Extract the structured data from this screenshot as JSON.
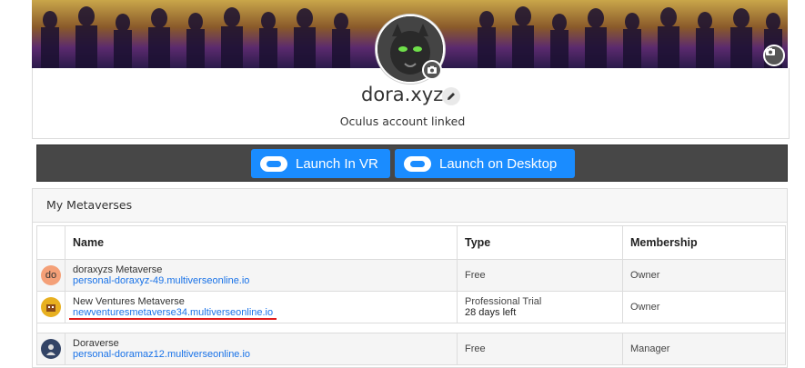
{
  "profile": {
    "username": "dora.xyz",
    "oculus_status": "Oculus account linked"
  },
  "launch": {
    "vr_label": "Launch In VR",
    "desktop_label": "Launch on Desktop"
  },
  "metaverses": {
    "title": "My Metaverses",
    "columns": {
      "name": "Name",
      "type": "Type",
      "membership": "Membership"
    },
    "rows": [
      {
        "icon_text": "do",
        "icon_color": "#f4a078",
        "name": "doraxyzs Metaverse",
        "url": "personal-doraxyz-49.multiverseonline.io",
        "type": "Free",
        "type_detail": "",
        "membership": "Owner"
      },
      {
        "icon_text": "",
        "icon_color": "#e8b020",
        "name": "New Ventures Metaverse",
        "url": "newventuresmetaverse34.multiverseonline.io",
        "type": "Professional Trial",
        "type_detail": "28 days left",
        "membership": "Owner"
      },
      {
        "icon_text": "",
        "icon_color": "#334466",
        "name": "Doraverse",
        "url": "personal-doramaz12.multiverseonline.io",
        "type": "Free",
        "type_detail": "",
        "membership": "Manager"
      }
    ]
  },
  "colors": {
    "accent": "#1a8cff",
    "link": "#1a73e8",
    "highlight_underline": "#e01b1b"
  }
}
